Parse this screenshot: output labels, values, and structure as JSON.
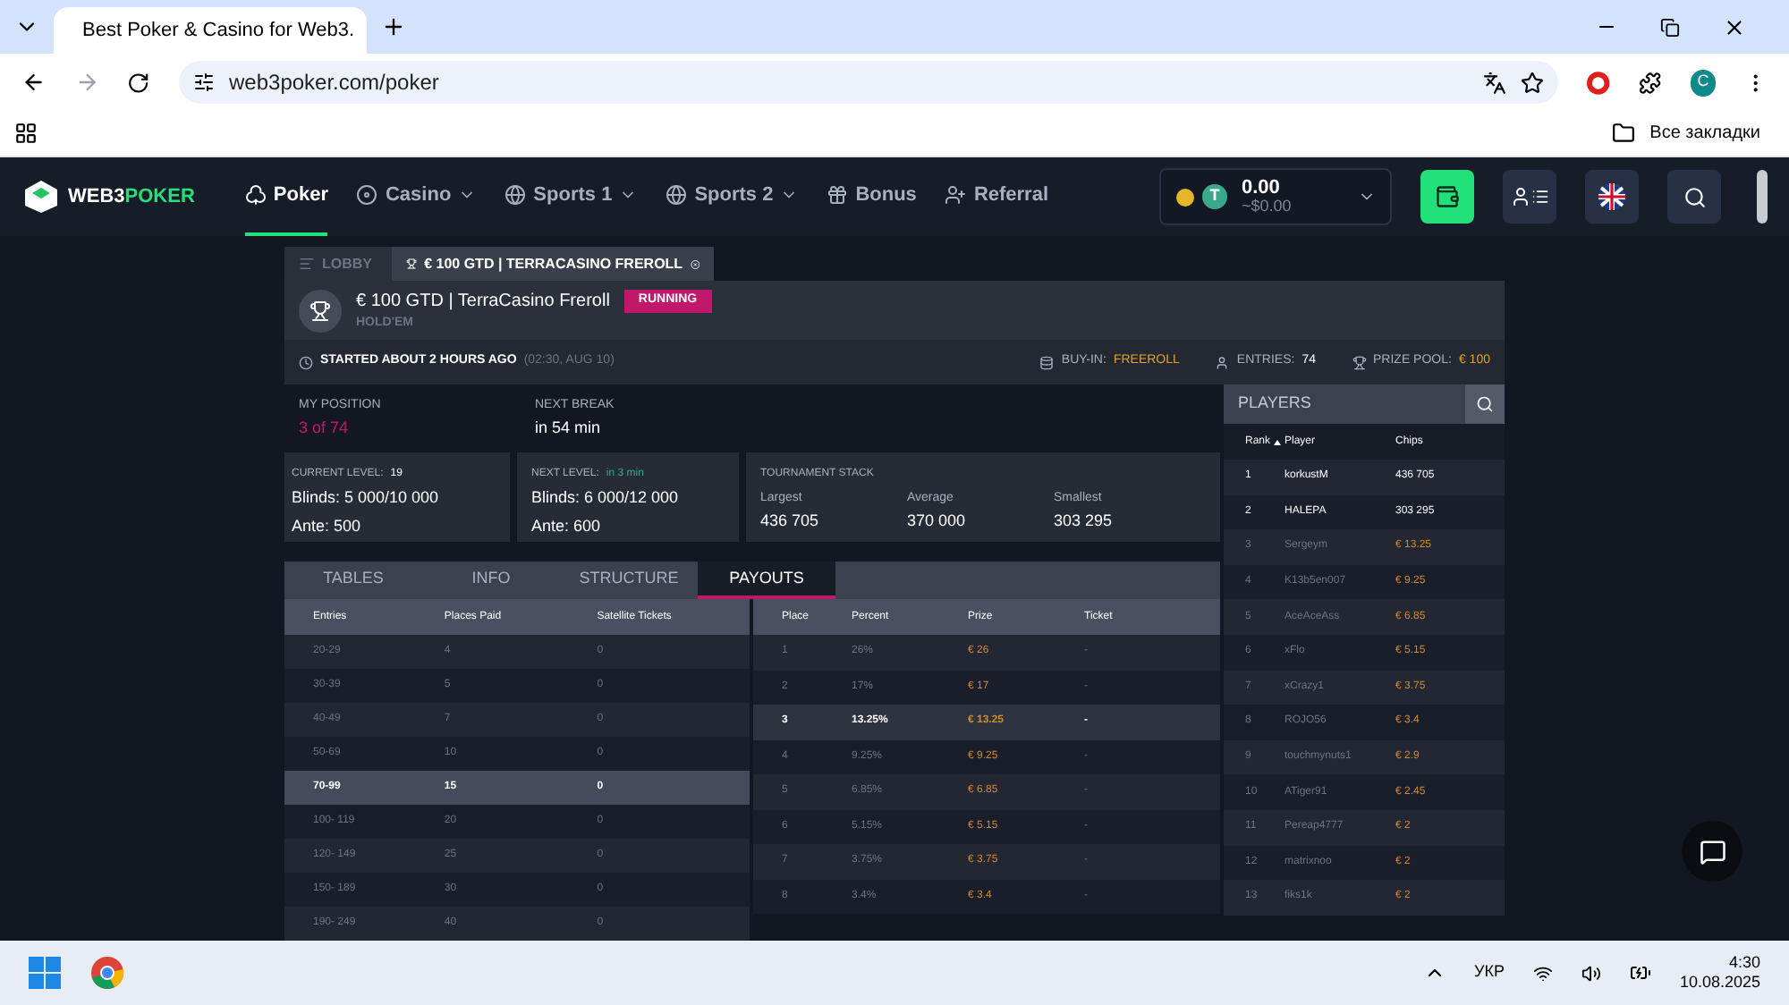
{
  "browser": {
    "tab_title": "Best Poker & Casino for Web3.",
    "url": "web3poker.com/poker",
    "avatar": "C",
    "bookmarks": "Все закладки"
  },
  "site": {
    "logo_a": "WEB3",
    "logo_b": "POKER",
    "nav": [
      {
        "label": "Poker",
        "selected": true,
        "dropdown": false
      },
      {
        "label": "Casino",
        "selected": false,
        "dropdown": true
      },
      {
        "label": "Sports 1",
        "selected": false,
        "dropdown": true
      },
      {
        "label": "Sports 2",
        "selected": false,
        "dropdown": true
      },
      {
        "label": "Bonus",
        "selected": false,
        "dropdown": false
      },
      {
        "label": "Referral",
        "selected": false,
        "dropdown": false
      }
    ],
    "balance": {
      "amount": "0.00",
      "usd": "~$0.00",
      "coin": "T"
    }
  },
  "tournament": {
    "tabs": [
      {
        "label": "LOBBY",
        "selected": false
      },
      {
        "label": "€ 100 GTD | TERRACASINO FREROLL",
        "selected": true
      }
    ],
    "title": "€ 100 GTD | TerraCasino Freroll",
    "status": "RUNNING",
    "game": "HOLD'EM",
    "started": "STARTED ABOUT 2 HOURS AGO",
    "started_time": "(02:30, AUG 10)",
    "buy_in_label": "BUY-IN:",
    "buy_in": "FREEROLL",
    "entries_label": "ENTRIES:",
    "entries": "74",
    "prize_label": "PRIZE POOL:",
    "prize": "€ 100",
    "position_label": "MY POSITION",
    "position": "3 of 74",
    "break_label": "NEXT BREAK",
    "break": "in 54 min",
    "current_label": "CURRENT LEVEL:",
    "current_level": "19",
    "current_blinds": "Blinds: 5 000/10 000",
    "current_ante": "Ante: 500",
    "next_label": "NEXT LEVEL:",
    "next_in": "in 3 min",
    "next_blinds": "Blinds: 6 000/12 000",
    "next_ante": "Ante: 600",
    "stack_label": "TOURNAMENT STACK",
    "stack": [
      {
        "label": "Largest",
        "value": "436 705"
      },
      {
        "label": "Average",
        "value": "370 000"
      },
      {
        "label": "Smallest",
        "value": "303 295"
      }
    ],
    "tabs2": [
      {
        "label": "TABLES",
        "selected": false
      },
      {
        "label": "INFO",
        "selected": false
      },
      {
        "label": "STRUCTURE",
        "selected": false
      },
      {
        "label": "PAYOUTS",
        "selected": true
      }
    ],
    "entries_table": {
      "columns": [
        "Entries",
        "Places Paid",
        "Satellite Tickets"
      ],
      "rows": [
        {
          "cells": [
            "20-29",
            "4",
            "0"
          ],
          "selected": false
        },
        {
          "cells": [
            "30-39",
            "5",
            "0"
          ],
          "selected": false
        },
        {
          "cells": [
            "40-49",
            "7",
            "0"
          ],
          "selected": false
        },
        {
          "cells": [
            "50-69",
            "10",
            "0"
          ],
          "selected": false
        },
        {
          "cells": [
            "70-99",
            "15",
            "0"
          ],
          "selected": true
        },
        {
          "cells": [
            "100- 119",
            "20",
            "0"
          ],
          "selected": false
        },
        {
          "cells": [
            "120- 149",
            "25",
            "0"
          ],
          "selected": false
        },
        {
          "cells": [
            "150- 189",
            "30",
            "0"
          ],
          "selected": false
        },
        {
          "cells": [
            "190- 249",
            "40",
            "0"
          ],
          "selected": false
        }
      ]
    },
    "payout_table": {
      "columns": [
        "Place",
        "Percent",
        "Prize",
        "Ticket"
      ],
      "rows": [
        {
          "cells": [
            "1",
            "26%",
            "€ 26",
            "-"
          ],
          "selected": false
        },
        {
          "cells": [
            "2",
            "17%",
            "€ 17",
            "-"
          ],
          "selected": false
        },
        {
          "cells": [
            "3",
            "13.25%",
            "€ 13.25",
            "-"
          ],
          "selected": true
        },
        {
          "cells": [
            "4",
            "9.25%",
            "€ 9.25",
            "-"
          ],
          "selected": false
        },
        {
          "cells": [
            "5",
            "6.85%",
            "€ 6.85",
            "-"
          ],
          "selected": false
        },
        {
          "cells": [
            "6",
            "5.15%",
            "€ 5.15",
            "-"
          ],
          "selected": false
        },
        {
          "cells": [
            "7",
            "3.75%",
            "€ 3.75",
            "-"
          ],
          "selected": false
        },
        {
          "cells": [
            "8",
            "3.4%",
            "€ 3.4",
            "-"
          ],
          "selected": false
        }
      ]
    },
    "players": {
      "title": "PLAYERS",
      "columns": [
        "Rank",
        "Player",
        "Chips"
      ],
      "rows": [
        {
          "cells": [
            "1",
            "korkustM",
            "436 705"
          ],
          "kind": "chips"
        },
        {
          "cells": [
            "2",
            "HALEPA",
            "303 295"
          ],
          "kind": "chips"
        },
        {
          "cells": [
            "3",
            "Sergeym",
            "€ 13.25"
          ],
          "kind": "prize"
        },
        {
          "cells": [
            "4",
            "K13b5en007",
            "€ 9.25"
          ],
          "kind": "prize"
        },
        {
          "cells": [
            "5",
            "AceAceAss",
            "€ 6.85"
          ],
          "kind": "prize"
        },
        {
          "cells": [
            "6",
            "xFlo",
            "€ 5.15"
          ],
          "kind": "prize"
        },
        {
          "cells": [
            "7",
            "xCrazy1",
            "€ 3.75"
          ],
          "kind": "prize"
        },
        {
          "cells": [
            "8",
            "ROJO56",
            "€ 3.4"
          ],
          "kind": "prize"
        },
        {
          "cells": [
            "9",
            "touchmynuts1",
            "€ 2.9"
          ],
          "kind": "prize"
        },
        {
          "cells": [
            "10",
            "ATiger91",
            "€ 2.45"
          ],
          "kind": "prize"
        },
        {
          "cells": [
            "11",
            "Pereap4777",
            "€ 2"
          ],
          "kind": "prize"
        },
        {
          "cells": [
            "12",
            "matrixnoo",
            "€ 2"
          ],
          "kind": "prize"
        },
        {
          "cells": [
            "13",
            "fiks1k",
            "€ 2"
          ],
          "kind": "prize"
        }
      ]
    }
  },
  "taskbar": {
    "lang": "УКР",
    "time": "4:30",
    "date": "10.08.2025"
  }
}
